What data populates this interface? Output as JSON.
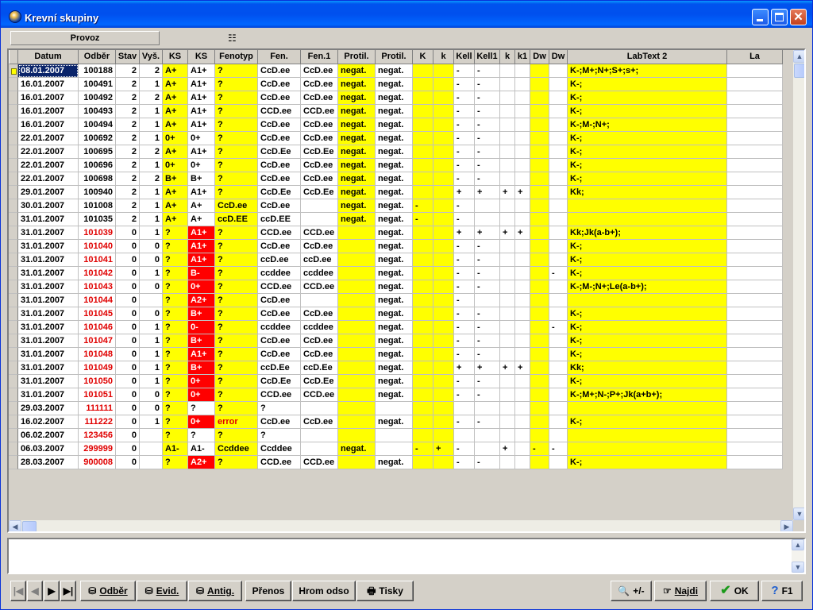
{
  "window": {
    "title": "Krevní skupiny"
  },
  "toolbar": {
    "provoz_label": "Provoz"
  },
  "grid": {
    "columns": [
      "Datum",
      "Odběr",
      "Stav",
      "Vyš.",
      "KS",
      "KS",
      "Fenotyp",
      "Fen.",
      "Fen.1",
      "Protil.",
      "Protil.",
      "K",
      "k",
      "Kell",
      "Kell1",
      "k",
      "k1",
      "Dw",
      "Dw",
      "LabText 2",
      "La"
    ],
    "rows": [
      [
        "08.01.2007",
        "100188",
        "2",
        "2",
        "A+",
        "A1+",
        "?",
        "CcD.ee",
        "CcD.ee",
        "negat.",
        "negat.",
        "",
        "",
        "-",
        "-",
        "",
        "",
        "",
        "",
        "K-;M+;N+;S+;s+;",
        ""
      ],
      [
        "16.01.2007",
        "100491",
        "2",
        "1",
        "A+",
        "A1+",
        "?",
        "CcD.ee",
        "CcD.ee",
        "negat.",
        "negat.",
        "",
        "",
        "-",
        "-",
        "",
        "",
        "",
        "",
        "K-;",
        ""
      ],
      [
        "16.01.2007",
        "100492",
        "2",
        "2",
        "A+",
        "A1+",
        "?",
        "CcD.ee",
        "CcD.ee",
        "negat.",
        "negat.",
        "",
        "",
        "-",
        "-",
        "",
        "",
        "",
        "",
        "K-;",
        ""
      ],
      [
        "16.01.2007",
        "100493",
        "2",
        "1",
        "A+",
        "A1+",
        "?",
        "CCD.ee",
        "CCD.ee",
        "negat.",
        "negat.",
        "",
        "",
        "-",
        "-",
        "",
        "",
        "",
        "",
        "K-;",
        ""
      ],
      [
        "16.01.2007",
        "100494",
        "2",
        "1",
        "A+",
        "A1+",
        "?",
        "CcD.ee",
        "CcD.ee",
        "negat.",
        "negat.",
        "",
        "",
        "-",
        "-",
        "",
        "",
        "",
        "",
        "K-;M-;N+;",
        ""
      ],
      [
        "22.01.2007",
        "100692",
        "2",
        "1",
        "0+",
        "0+",
        "?",
        "CcD.ee",
        "CcD.ee",
        "negat.",
        "negat.",
        "",
        "",
        "-",
        "-",
        "",
        "",
        "",
        "",
        "K-;",
        ""
      ],
      [
        "22.01.2007",
        "100695",
        "2",
        "2",
        "A+",
        "A1+",
        "?",
        "CcD.Ee",
        "CcD.Ee",
        "negat.",
        "negat.",
        "",
        "",
        "-",
        "-",
        "",
        "",
        "",
        "",
        "K-;",
        ""
      ],
      [
        "22.01.2007",
        "100696",
        "2",
        "1",
        "0+",
        "0+",
        "?",
        "CcD.ee",
        "CcD.ee",
        "negat.",
        "negat.",
        "",
        "",
        "-",
        "-",
        "",
        "",
        "",
        "",
        "K-;",
        ""
      ],
      [
        "22.01.2007",
        "100698",
        "2",
        "2",
        "B+",
        "B+",
        "?",
        "CcD.ee",
        "CcD.ee",
        "negat.",
        "negat.",
        "",
        "",
        "-",
        "-",
        "",
        "",
        "",
        "",
        "K-;",
        ""
      ],
      [
        "29.01.2007",
        "100940",
        "2",
        "1",
        "A+",
        "A1+",
        "?",
        "CcD.Ee",
        "CcD.Ee",
        "negat.",
        "negat.",
        "",
        "",
        "+",
        "+",
        "+",
        "+",
        "",
        "",
        "Kk;",
        ""
      ],
      [
        "30.01.2007",
        "101008",
        "2",
        "1",
        "A+",
        "A+",
        "CcD.ee",
        "CcD.ee",
        "",
        "negat.",
        "negat.",
        "-",
        "",
        "-",
        "",
        "",
        "",
        "",
        "",
        "",
        ""
      ],
      [
        "31.01.2007",
        "101035",
        "2",
        "1",
        "A+",
        "A+",
        "ccD.EE",
        "ccD.EE",
        "",
        "negat.",
        "negat.",
        "-",
        "",
        "-",
        "",
        "",
        "",
        "",
        "",
        "",
        ""
      ],
      [
        "31.01.2007",
        "101039",
        "0",
        "1",
        "?",
        "A1+",
        "?",
        "CCD.ee",
        "CCD.ee",
        "",
        "negat.",
        "",
        "",
        "+",
        "+",
        "+",
        "+",
        "",
        "",
        "Kk;Jk(a-b+);",
        ""
      ],
      [
        "31.01.2007",
        "101040",
        "0",
        "0",
        "?",
        "A1+",
        "?",
        "CcD.ee",
        "CcD.ee",
        "",
        "negat.",
        "",
        "",
        "-",
        "-",
        "",
        "",
        "",
        "",
        "K-;",
        ""
      ],
      [
        "31.01.2007",
        "101041",
        "0",
        "0",
        "?",
        "A1+",
        "?",
        "ccD.ee",
        "ccD.ee",
        "",
        "negat.",
        "",
        "",
        "-",
        "-",
        "",
        "",
        "",
        "",
        "K-;",
        ""
      ],
      [
        "31.01.2007",
        "101042",
        "0",
        "1",
        "?",
        "B-",
        "?",
        "ccddee",
        "ccddee",
        "",
        "negat.",
        "",
        "",
        "-",
        "-",
        "",
        "",
        "",
        "-",
        "K-;",
        ""
      ],
      [
        "31.01.2007",
        "101043",
        "0",
        "0",
        "?",
        "0+",
        "?",
        "CCD.ee",
        "CCD.ee",
        "",
        "negat.",
        "",
        "",
        "-",
        "-",
        "",
        "",
        "",
        "",
        "K-;M-;N+;Le(a-b+);",
        ""
      ],
      [
        "31.01.2007",
        "101044",
        "0",
        "",
        "?",
        "A2+",
        "?",
        "CcD.ee",
        "",
        "",
        "negat.",
        "",
        "",
        "-",
        "",
        "",
        "",
        "",
        "",
        "",
        ""
      ],
      [
        "31.01.2007",
        "101045",
        "0",
        "0",
        "?",
        "B+",
        "?",
        "CcD.ee",
        "CcD.ee",
        "",
        "negat.",
        "",
        "",
        "-",
        "-",
        "",
        "",
        "",
        "",
        "K-;",
        ""
      ],
      [
        "31.01.2007",
        "101046",
        "0",
        "1",
        "?",
        "0-",
        "?",
        "ccddee",
        "ccddee",
        "",
        "negat.",
        "",
        "",
        "-",
        "-",
        "",
        "",
        "",
        "-",
        "K-;",
        ""
      ],
      [
        "31.01.2007",
        "101047",
        "0",
        "1",
        "?",
        "B+",
        "?",
        "CcD.ee",
        "CcD.ee",
        "",
        "negat.",
        "",
        "",
        "-",
        "-",
        "",
        "",
        "",
        "",
        "K-;",
        ""
      ],
      [
        "31.01.2007",
        "101048",
        "0",
        "1",
        "?",
        "A1+",
        "?",
        "CcD.ee",
        "CcD.ee",
        "",
        "negat.",
        "",
        "",
        "-",
        "-",
        "",
        "",
        "",
        "",
        "K-;",
        ""
      ],
      [
        "31.01.2007",
        "101049",
        "0",
        "1",
        "?",
        "B+",
        "?",
        "ccD.Ee",
        "ccD.Ee",
        "",
        "negat.",
        "",
        "",
        "+",
        "+",
        "+",
        "+",
        "",
        "",
        "Kk;",
        ""
      ],
      [
        "31.01.2007",
        "101050",
        "0",
        "1",
        "?",
        "0+",
        "?",
        "CcD.Ee",
        "CcD.Ee",
        "",
        "negat.",
        "",
        "",
        "-",
        "-",
        "",
        "",
        "",
        "",
        "K-;",
        ""
      ],
      [
        "31.01.2007",
        "101051",
        "0",
        "0",
        "?",
        "0+",
        "?",
        "CCD.ee",
        "CCD.ee",
        "",
        "negat.",
        "",
        "",
        "-",
        "-",
        "",
        "",
        "",
        "",
        "K-;M+;N-;P+;Jk(a+b+);",
        ""
      ],
      [
        "29.03.2007",
        "111111",
        "0",
        "0",
        "?",
        "?",
        "?",
        "?",
        "",
        "",
        "",
        "",
        "",
        "",
        "",
        "",
        "",
        "",
        "",
        "",
        ""
      ],
      [
        "16.02.2007",
        "111222",
        "0",
        "1",
        "?",
        "0+",
        "error",
        "CcD.ee",
        "CcD.ee",
        "",
        "negat.",
        "",
        "",
        "-",
        "-",
        "",
        "",
        "",
        "",
        "K-;",
        ""
      ],
      [
        "06.02.2007",
        "123456",
        "0",
        "",
        "?",
        "?",
        "?",
        "?",
        "",
        "",
        "",
        "",
        "",
        "",
        "",
        "",
        "",
        "",
        "",
        "",
        ""
      ],
      [
        "06.03.2007",
        "299999",
        "0",
        "",
        "A1-",
        "A1-",
        "Ccddee",
        "Ccddee",
        "",
        "negat.",
        "",
        "-",
        "+",
        "-",
        "",
        "+",
        "",
        "-",
        "-",
        "",
        ""
      ],
      [
        "28.03.2007",
        "900008",
        "0",
        "",
        "?",
        "A2+",
        "?",
        "CCD.ee",
        "CCD.ee",
        "",
        "negat.",
        "",
        "",
        "-",
        "-",
        "",
        "",
        "",
        "",
        "K-;",
        ""
      ]
    ]
  },
  "bottom": {
    "odber": "Odběr",
    "evid": "Evid.",
    "antig": "Antig.",
    "prenos": "Přenos",
    "hrom": "Hrom odso",
    "tisky": "Tisky",
    "zoom": "+/-",
    "najdi": "Najdi",
    "ok": "OK",
    "f1": "F1"
  },
  "colors": {
    "highlight_yellow": "#ffff00",
    "alert_red": "#ff0000",
    "title_blue": "#0054e3"
  },
  "icons": [
    "globe-icon",
    "minimize-icon",
    "maximize-icon",
    "close-icon",
    "tree-icon",
    "first-icon",
    "prev-icon",
    "next-icon",
    "last-icon",
    "print-icon",
    "zoom-icon",
    "hand-icon",
    "check-icon",
    "help-icon"
  ]
}
